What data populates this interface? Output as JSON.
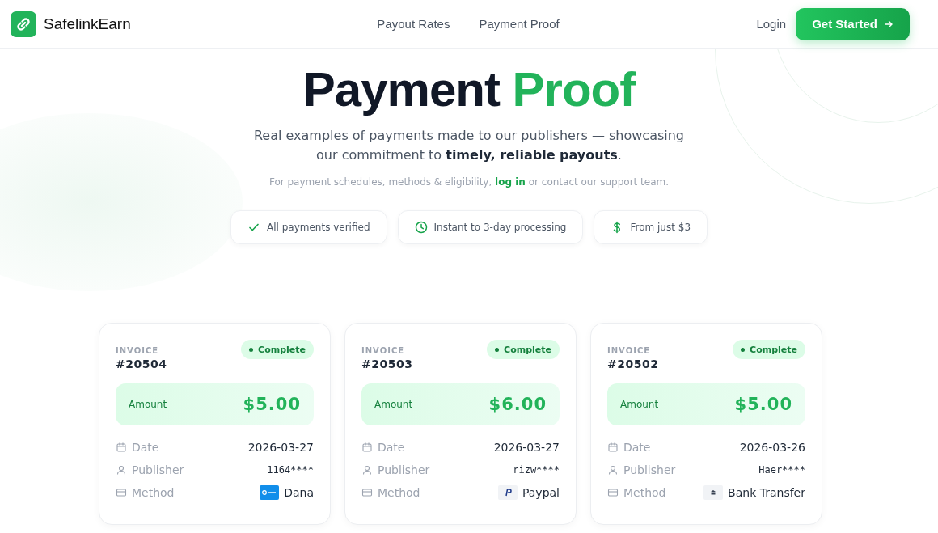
{
  "brand": {
    "name": "SafelinkEarn"
  },
  "nav": [
    {
      "label": "Payout Rates"
    },
    {
      "label": "Payment Proof"
    }
  ],
  "login": "Login",
  "cta": "Get Started",
  "hero": {
    "title": "Payment",
    "title_accent": "Proof",
    "subtitle": "Real examples of payments made to our publishers — showcasing our commitment to **timely, reliable payouts**.",
    "note_before": "For payment schedules, methods & eligibility,",
    "note_link": "log in",
    "note_after": "or contact our support team."
  },
  "features": [
    {
      "kind": "check",
      "label": "All payments verified"
    },
    {
      "kind": "clock",
      "label": "Instant to 3-day processing"
    },
    {
      "kind": "dollar",
      "label": "From just $3"
    }
  ],
  "invoices": [
    {
      "label": "INVOICE",
      "number": "#20504",
      "status": "Complete",
      "amount_label": "Amount",
      "amount": "$5.00",
      "date_label": "Date",
      "date": "2026-03-27",
      "publisher_label": "Publisher",
      "publisher": "1164****",
      "method_label": "Method",
      "method": {
        "name": "Dana",
        "kind": "dana"
      }
    },
    {
      "label": "INVOICE",
      "number": "#20503",
      "status": "Complete",
      "amount_label": "Amount",
      "amount": "$6.00",
      "date_label": "Date",
      "date": "2026-03-27",
      "publisher_label": "Publisher",
      "publisher": "rizw****",
      "method_label": "Method",
      "method": {
        "name": "Paypal",
        "kind": "paypal"
      }
    },
    {
      "label": "INVOICE",
      "number": "#20502",
      "status": "Complete",
      "amount_label": "Amount",
      "amount": "$5.00",
      "date_label": "Date",
      "date": "2026-03-26",
      "publisher_label": "Publisher",
      "publisher": "Haer****",
      "method_label": "Method",
      "method": {
        "name": "Bank Transfer",
        "kind": "bank"
      }
    }
  ]
}
